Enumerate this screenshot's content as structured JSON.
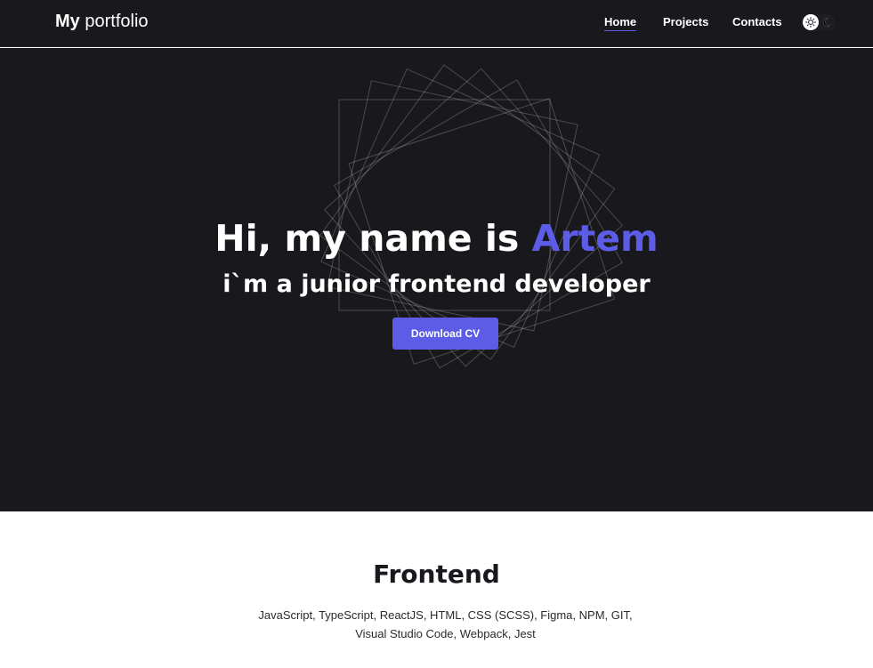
{
  "header": {
    "logo_bold": "My",
    "logo_rest": "portfolio",
    "nav": {
      "home": "Home",
      "projects": "Projects",
      "contacts": "Contacts"
    },
    "theme_toggle": {
      "light_icon": "sun-icon",
      "dark_icon": "moon-icon"
    }
  },
  "hero": {
    "title_prefix": "Hi, my name is",
    "title_name": "Artem",
    "subtitle": "i`m a junior frontend developer",
    "cv_button": "Download CV"
  },
  "skills": {
    "title": "Frontend",
    "line1": "JavaScript, TypeScript, ReactJS, HTML, CSS (SCSS), Figma, NPM, GIT,",
    "line2": "Visual Studio Code, Webpack, Jest"
  },
  "colors": {
    "background_dark": "#19181c",
    "accent": "#5c5ce6",
    "text_light": "#ffffff"
  }
}
